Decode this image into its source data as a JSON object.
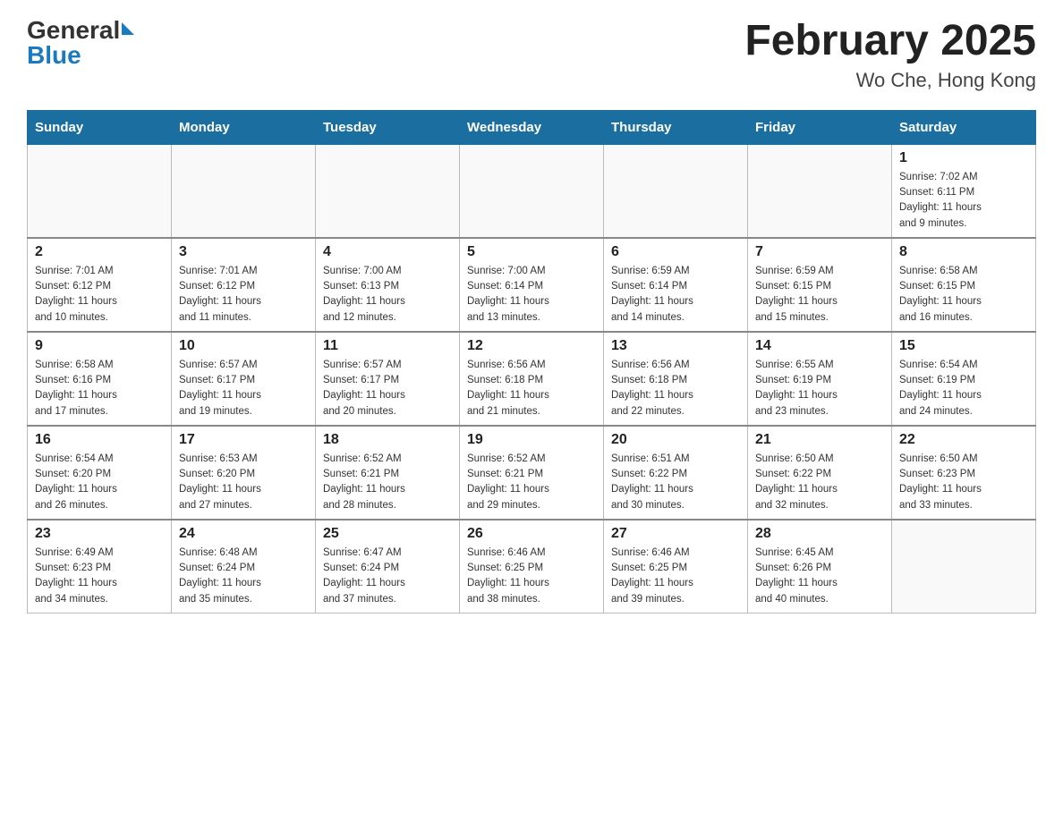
{
  "header": {
    "logo_general": "General",
    "logo_blue": "Blue",
    "month_title": "February 2025",
    "location": "Wo Che, Hong Kong"
  },
  "weekdays": [
    "Sunday",
    "Monday",
    "Tuesday",
    "Wednesday",
    "Thursday",
    "Friday",
    "Saturday"
  ],
  "weeks": [
    [
      {
        "day": "",
        "info": ""
      },
      {
        "day": "",
        "info": ""
      },
      {
        "day": "",
        "info": ""
      },
      {
        "day": "",
        "info": ""
      },
      {
        "day": "",
        "info": ""
      },
      {
        "day": "",
        "info": ""
      },
      {
        "day": "1",
        "info": "Sunrise: 7:02 AM\nSunset: 6:11 PM\nDaylight: 11 hours\nand 9 minutes."
      }
    ],
    [
      {
        "day": "2",
        "info": "Sunrise: 7:01 AM\nSunset: 6:12 PM\nDaylight: 11 hours\nand 10 minutes."
      },
      {
        "day": "3",
        "info": "Sunrise: 7:01 AM\nSunset: 6:12 PM\nDaylight: 11 hours\nand 11 minutes."
      },
      {
        "day": "4",
        "info": "Sunrise: 7:00 AM\nSunset: 6:13 PM\nDaylight: 11 hours\nand 12 minutes."
      },
      {
        "day": "5",
        "info": "Sunrise: 7:00 AM\nSunset: 6:14 PM\nDaylight: 11 hours\nand 13 minutes."
      },
      {
        "day": "6",
        "info": "Sunrise: 6:59 AM\nSunset: 6:14 PM\nDaylight: 11 hours\nand 14 minutes."
      },
      {
        "day": "7",
        "info": "Sunrise: 6:59 AM\nSunset: 6:15 PM\nDaylight: 11 hours\nand 15 minutes."
      },
      {
        "day": "8",
        "info": "Sunrise: 6:58 AM\nSunset: 6:15 PM\nDaylight: 11 hours\nand 16 minutes."
      }
    ],
    [
      {
        "day": "9",
        "info": "Sunrise: 6:58 AM\nSunset: 6:16 PM\nDaylight: 11 hours\nand 17 minutes."
      },
      {
        "day": "10",
        "info": "Sunrise: 6:57 AM\nSunset: 6:17 PM\nDaylight: 11 hours\nand 19 minutes."
      },
      {
        "day": "11",
        "info": "Sunrise: 6:57 AM\nSunset: 6:17 PM\nDaylight: 11 hours\nand 20 minutes."
      },
      {
        "day": "12",
        "info": "Sunrise: 6:56 AM\nSunset: 6:18 PM\nDaylight: 11 hours\nand 21 minutes."
      },
      {
        "day": "13",
        "info": "Sunrise: 6:56 AM\nSunset: 6:18 PM\nDaylight: 11 hours\nand 22 minutes."
      },
      {
        "day": "14",
        "info": "Sunrise: 6:55 AM\nSunset: 6:19 PM\nDaylight: 11 hours\nand 23 minutes."
      },
      {
        "day": "15",
        "info": "Sunrise: 6:54 AM\nSunset: 6:19 PM\nDaylight: 11 hours\nand 24 minutes."
      }
    ],
    [
      {
        "day": "16",
        "info": "Sunrise: 6:54 AM\nSunset: 6:20 PM\nDaylight: 11 hours\nand 26 minutes."
      },
      {
        "day": "17",
        "info": "Sunrise: 6:53 AM\nSunset: 6:20 PM\nDaylight: 11 hours\nand 27 minutes."
      },
      {
        "day": "18",
        "info": "Sunrise: 6:52 AM\nSunset: 6:21 PM\nDaylight: 11 hours\nand 28 minutes."
      },
      {
        "day": "19",
        "info": "Sunrise: 6:52 AM\nSunset: 6:21 PM\nDaylight: 11 hours\nand 29 minutes."
      },
      {
        "day": "20",
        "info": "Sunrise: 6:51 AM\nSunset: 6:22 PM\nDaylight: 11 hours\nand 30 minutes."
      },
      {
        "day": "21",
        "info": "Sunrise: 6:50 AM\nSunset: 6:22 PM\nDaylight: 11 hours\nand 32 minutes."
      },
      {
        "day": "22",
        "info": "Sunrise: 6:50 AM\nSunset: 6:23 PM\nDaylight: 11 hours\nand 33 minutes."
      }
    ],
    [
      {
        "day": "23",
        "info": "Sunrise: 6:49 AM\nSunset: 6:23 PM\nDaylight: 11 hours\nand 34 minutes."
      },
      {
        "day": "24",
        "info": "Sunrise: 6:48 AM\nSunset: 6:24 PM\nDaylight: 11 hours\nand 35 minutes."
      },
      {
        "day": "25",
        "info": "Sunrise: 6:47 AM\nSunset: 6:24 PM\nDaylight: 11 hours\nand 37 minutes."
      },
      {
        "day": "26",
        "info": "Sunrise: 6:46 AM\nSunset: 6:25 PM\nDaylight: 11 hours\nand 38 minutes."
      },
      {
        "day": "27",
        "info": "Sunrise: 6:46 AM\nSunset: 6:25 PM\nDaylight: 11 hours\nand 39 minutes."
      },
      {
        "day": "28",
        "info": "Sunrise: 6:45 AM\nSunset: 6:26 PM\nDaylight: 11 hours\nand 40 minutes."
      },
      {
        "day": "",
        "info": ""
      }
    ]
  ]
}
